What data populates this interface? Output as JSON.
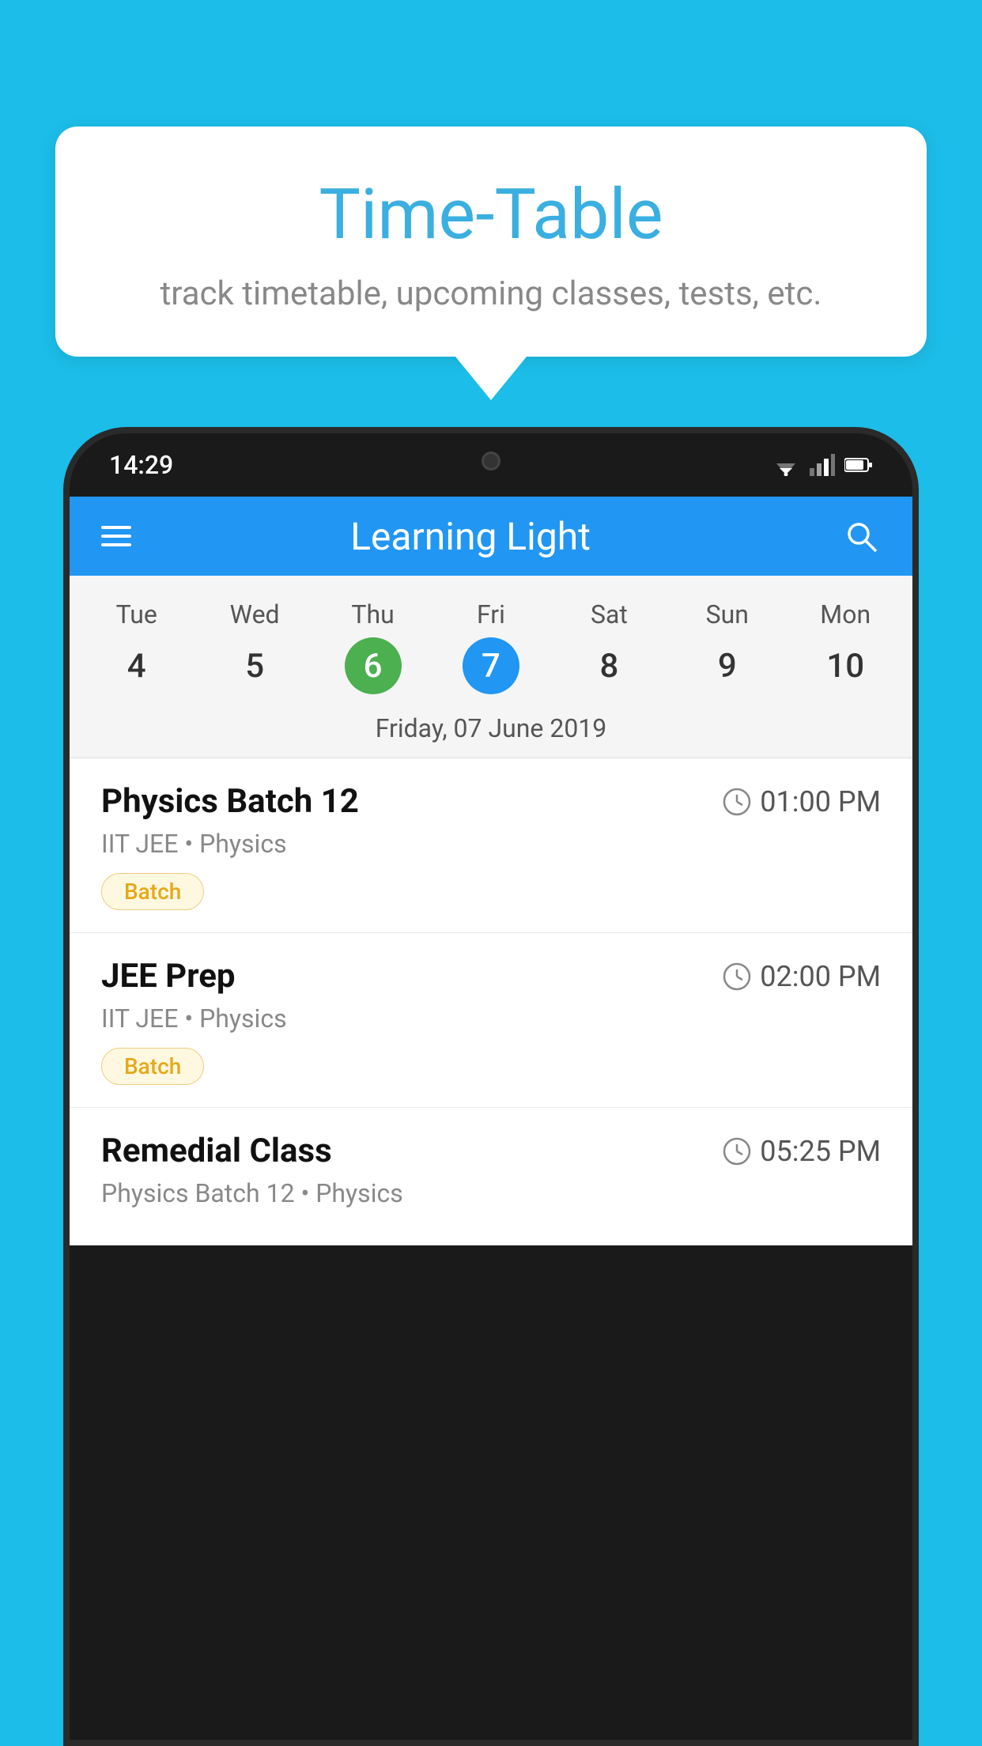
{
  "background_color": "#1CBDE8",
  "speech_bubble": {
    "title": "Time-Table",
    "subtitle": "track timetable, upcoming classes, tests, etc."
  },
  "phone": {
    "status_bar": {
      "time": "14:29"
    },
    "app_header": {
      "title": "Learning Light"
    },
    "calendar": {
      "days": [
        {
          "name": "Tue",
          "number": "4",
          "state": "normal"
        },
        {
          "name": "Wed",
          "number": "5",
          "state": "normal"
        },
        {
          "name": "Thu",
          "number": "6",
          "state": "today"
        },
        {
          "name": "Fri",
          "number": "7",
          "state": "selected"
        },
        {
          "name": "Sat",
          "number": "8",
          "state": "normal"
        },
        {
          "name": "Sun",
          "number": "9",
          "state": "normal"
        },
        {
          "name": "Mon",
          "number": "10",
          "state": "normal"
        }
      ],
      "selected_date_label": "Friday, 07 June 2019"
    },
    "schedule": [
      {
        "name": "Physics Batch 12",
        "time": "01:00 PM",
        "subtitle": "IIT JEE • Physics",
        "badge": "Batch"
      },
      {
        "name": "JEE Prep",
        "time": "02:00 PM",
        "subtitle": "IIT JEE • Physics",
        "badge": "Batch"
      },
      {
        "name": "Remedial Class",
        "time": "05:25 PM",
        "subtitle": "Physics Batch 12 • Physics",
        "badge": null
      }
    ]
  }
}
